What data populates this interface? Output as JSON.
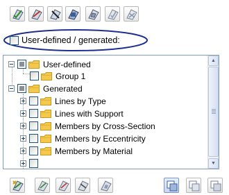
{
  "toolbar_top": {
    "buttons": [
      {
        "icon": "select-all-icon"
      },
      {
        "icon": "select-members-icon"
      },
      {
        "icon": "select-lines-icon"
      },
      {
        "icon": "select-surfaces-icon"
      },
      {
        "icon": "select-solids-icon"
      },
      {
        "icon": "deselect-icon"
      },
      {
        "icon": "invert-selection-icon"
      }
    ]
  },
  "filter": {
    "label": "User-defined / generated:",
    "checked": false,
    "highlight_color": "#1d2f8f"
  },
  "tree": {
    "items": [
      {
        "label": "User-defined",
        "level": 0,
        "expander": "minus",
        "check": "partial"
      },
      {
        "label": "Group 1",
        "level": 1,
        "expander": "none",
        "check": "unchecked"
      },
      {
        "label": "Generated",
        "level": 0,
        "expander": "minus",
        "check": "partial"
      },
      {
        "label": "Lines by Type",
        "level": 1,
        "expander": "plus",
        "check": "unchecked"
      },
      {
        "label": "Lines with Support",
        "level": 1,
        "expander": "plus",
        "check": "unchecked"
      },
      {
        "label": "Members by Cross-Section",
        "level": 1,
        "expander": "plus",
        "check": "unchecked"
      },
      {
        "label": "Members by Eccentricity",
        "level": 1,
        "expander": "plus",
        "check": "unchecked"
      },
      {
        "label": "Members by Material",
        "level": 1,
        "expander": "plus",
        "check": "unchecked"
      }
    ]
  },
  "toolbar_bottom": {
    "buttons": [
      {
        "icon": "new-group-icon"
      },
      {
        "icon": "edit-group-icon"
      },
      {
        "icon": "copy-group-icon"
      },
      {
        "icon": "delete-group-icon"
      },
      {
        "icon": "group-properties-icon"
      },
      {
        "icon": "show-selected-icon",
        "active": true
      },
      {
        "icon": "hide-selected-icon"
      },
      {
        "icon": "show-all-icon"
      }
    ]
  },
  "colors": {
    "folder": "#f2c94c",
    "tree_border": "#7f9db9",
    "checkbox_border": "#1c5180"
  }
}
